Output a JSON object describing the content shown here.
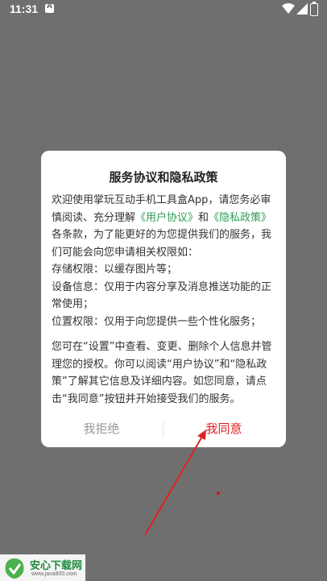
{
  "status_bar": {
    "time": "11:31"
  },
  "dialog": {
    "title": "服务协议和隐私政策",
    "body": [
      [
        {
          "text": "欢迎使用掌玩互动手机工具盒App，请您务必审慎阅读、充分理解",
          "link": false
        },
        {
          "text": "《用户协议》",
          "link": true
        },
        {
          "text": "和",
          "link": false
        },
        {
          "text": "《隐私政策》",
          "link": true
        },
        {
          "text": "各条款，为了能更好的为您提供我们的服务，我们可能会向您申请相关权限如：",
          "link": false
        }
      ],
      [
        {
          "text": "存储权限：以缓存图片等；",
          "link": false
        }
      ],
      [
        {
          "text": "设备信息：仅用于内容分享及消息推送功能的正常使用；",
          "link": false
        }
      ],
      [
        {
          "text": "位置权限：仅用于向您提供一些个性化服务；",
          "link": false
        }
      ],
      "gap",
      [
        {
          "text": "您可在“设置”中查看、变更、删除个人信息并管理您的授权。你可以阅读“用户协议”和“隐私政策”了解其它信息及详细内容。如您同意，请点击“我同意”按钮并开始接受我们的服务。",
          "link": false
        }
      ]
    ],
    "reject_label": "我拒绝",
    "agree_label": "我同意"
  },
  "watermark": {
    "title": "安心下载网",
    "url": "www.java800.com"
  },
  "colors": {
    "overlay": "#6f6f6f",
    "link": "#2f9c56",
    "agree": "#dd2222",
    "reject": "#999999"
  }
}
